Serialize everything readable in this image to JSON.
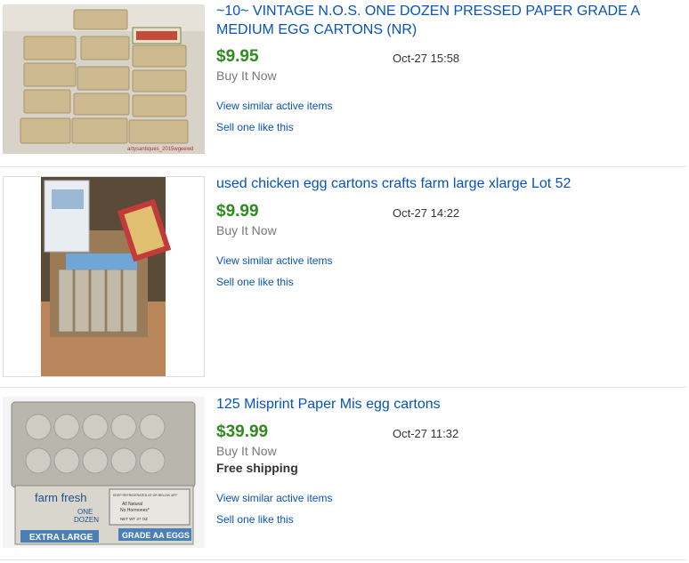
{
  "listings": [
    {
      "title": "~10~ VINTAGE N.O.S. ONE DOZEN PRESSED PAPER GRADE A MEDIUM EGG CARTONS (NR)",
      "price": "$9.95",
      "format": "Buy It Now",
      "shipping": "",
      "date": "Oct-27  15:58",
      "similar_link": "View similar active items",
      "sell_link": "Sell one like this",
      "watermark": "artysantiques_2015wgeewd"
    },
    {
      "title": "used chicken egg cartons crafts farm large xlarge Lot 52",
      "price": "$9.99",
      "format": "Buy It Now",
      "shipping": "",
      "date": "Oct-27  14:22",
      "similar_link": "View similar active items",
      "sell_link": "Sell one like this"
    },
    {
      "title": "125 Misprint Paper Mis egg cartons",
      "price": "$39.99",
      "format": "Buy It Now",
      "shipping": "Free shipping",
      "date": "Oct-27  11:32",
      "similar_link": "View similar active items",
      "sell_link": "Sell one like this",
      "image_text": {
        "brand": "farm fresh",
        "one": "ONE",
        "dozen": "DOZEN",
        "size": "EXTRA LARGE",
        "grade": "GRADE AA EGGS",
        "keep": "KEEP REFRIGERATED AT OR BELOW 45°F",
        "natural": "All Natural",
        "hormones": "No Hormones*",
        "net_wt": "NET WT 27 OZ"
      }
    }
  ],
  "colors": {
    "link": "#0654ba",
    "price": "#2e8b1f",
    "divider": "#e5e5e5"
  }
}
